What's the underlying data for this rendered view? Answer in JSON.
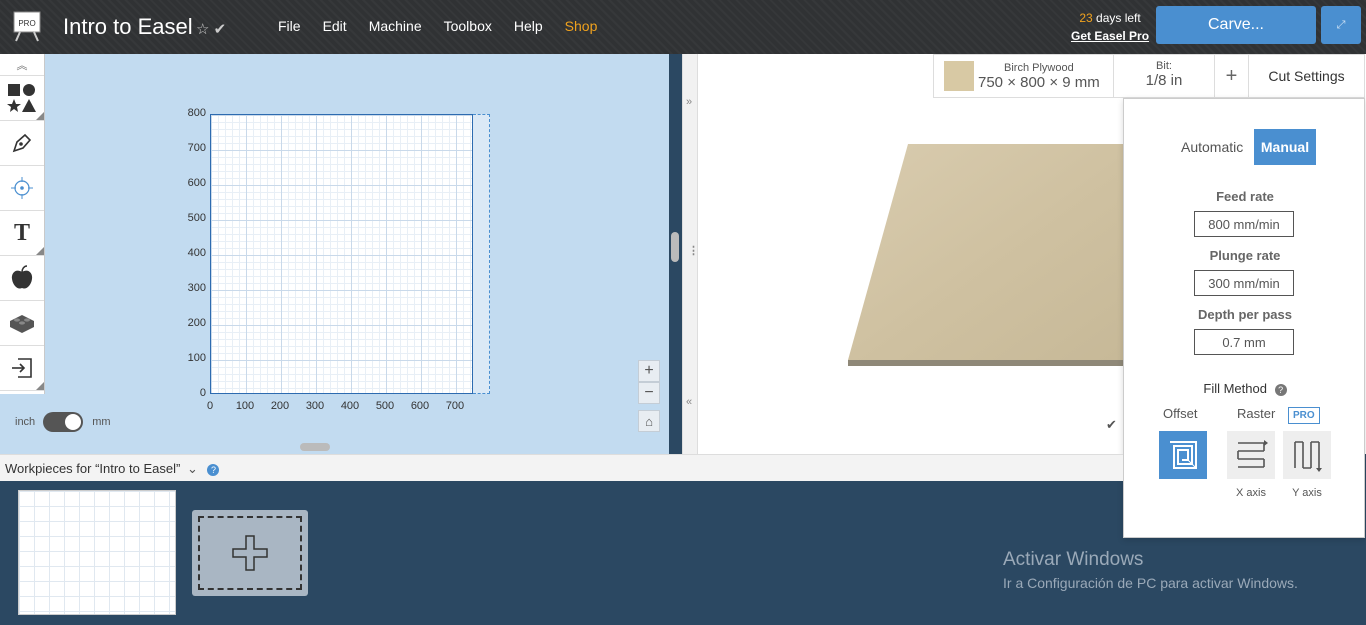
{
  "header": {
    "badge": "PRO",
    "project_title": "Intro to Easel",
    "menu": [
      "File",
      "Edit",
      "Machine",
      "Toolbox",
      "Help",
      "Shop"
    ],
    "trial_days": "23",
    "trial_suffix": " days left",
    "get_pro": "Get Easel Pro",
    "carve_label": "Carve..."
  },
  "design": {
    "y_ticks": [
      "800",
      "700",
      "600",
      "500",
      "400",
      "300",
      "200",
      "100",
      "0"
    ],
    "x_ticks": [
      "0",
      "100",
      "200",
      "300",
      "400",
      "500",
      "600",
      "700"
    ],
    "unit_left": "inch",
    "unit_right": "mm",
    "unit_selected": "mm"
  },
  "material_bar": {
    "material_name": "Birch Plywood",
    "dimensions": "750 × 800 × 9 mm",
    "bit_label": "Bit:",
    "bit_value": "1/8 in",
    "cut_settings_label": "Cut Settings"
  },
  "cut_settings": {
    "mode_auto": "Automatic",
    "mode_manual": "Manual",
    "feed_rate_label": "Feed rate",
    "feed_rate": "800 mm/min",
    "plunge_rate_label": "Plunge rate",
    "plunge_rate": "300 mm/min",
    "depth_label": "Depth per pass",
    "depth": "0.7 mm",
    "fill_method_label": "Fill Method",
    "fill_offset": "Offset",
    "fill_raster": "Raster",
    "pro_badge": "PRO",
    "x_axis": "X axis",
    "y_axis": "Y axis"
  },
  "workpieces": {
    "label": "Workpieces for “Intro to Easel”"
  },
  "watermark": {
    "title": "Activar Windows",
    "subtitle": "Ir a Configuración de PC para activar Windows."
  },
  "colors": {
    "accent": "#4a8fd0",
    "shop": "#f0a21e",
    "design_bg": "#c2dbf0",
    "workpieces_bg": "#2b4862"
  }
}
